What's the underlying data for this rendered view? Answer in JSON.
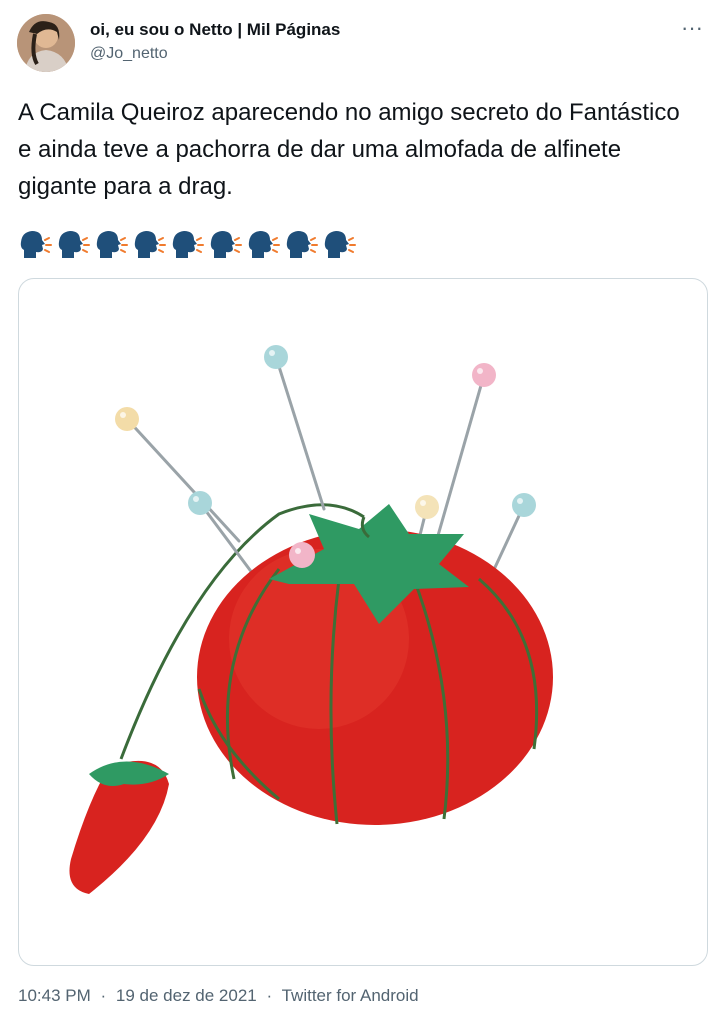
{
  "tweet": {
    "display_name": "oi, eu sou o Netto | Mil Páginas",
    "handle": "@Jo_netto",
    "more_label": "···",
    "text": "A Camila Queiroz aparecendo no amigo secreto do Fantástico e ainda teve a pachorra de dar uma almofada de alfinete gigante para a drag.",
    "emoji_icon": "speaking-head-icon",
    "emoji_count": 9,
    "media": {
      "image_name": "tomato-pincushion-photo"
    },
    "timestamp_time": "10:43 PM",
    "timestamp_date": "19 de dez de 2021",
    "source": "Twitter for Android",
    "separator": "·"
  },
  "colors": {
    "text_primary": "#0f1419",
    "text_secondary": "#536471",
    "border": "#cfd9de",
    "pincushion_red": "#d8231f",
    "leaf_green": "#2f9a63"
  }
}
